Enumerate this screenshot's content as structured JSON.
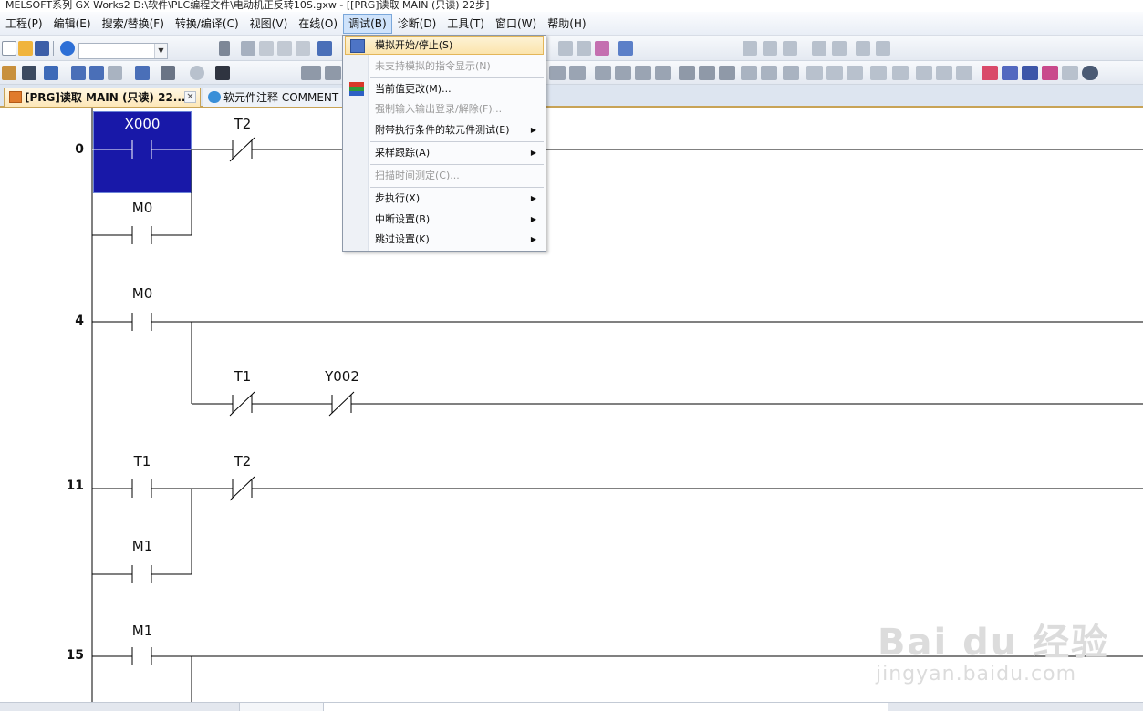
{
  "window": {
    "title": "MELSOFT系列 GX Works2 D:\\软件\\PLC编程文件\\电动机正反转10S.gxw - [[PRG]读取 MAIN (只读) 22步]"
  },
  "menubar": {
    "items": [
      {
        "label": "工程(P)"
      },
      {
        "label": "编辑(E)"
      },
      {
        "label": "搜索/替换(F)"
      },
      {
        "label": "转换/编译(C)"
      },
      {
        "label": "视图(V)"
      },
      {
        "label": "在线(O)"
      },
      {
        "label": "调试(B)",
        "active": true
      },
      {
        "label": "诊断(D)"
      },
      {
        "label": "工具(T)"
      },
      {
        "label": "窗口(W)"
      },
      {
        "label": "帮助(H)"
      }
    ]
  },
  "debug_menu": {
    "items": [
      {
        "label": "模拟开始/停止(S)",
        "enabled": true,
        "highlighted": true,
        "icon": "simulation-icon"
      },
      {
        "label": "未支持模拟的指令显示(N)",
        "enabled": false
      },
      {
        "label": "当前值更改(M)...",
        "enabled": true,
        "icon": "device-value-icon"
      },
      {
        "label": "强制输入输出登录/解除(F)...",
        "enabled": false
      },
      {
        "label": "附带执行条件的软元件测试(E)",
        "enabled": true,
        "submenu": true
      },
      {
        "label": "采样跟踪(A)",
        "enabled": true,
        "submenu": true
      },
      {
        "label": "扫描时间测定(C)...",
        "enabled": false
      },
      {
        "label": "步执行(X)",
        "enabled": true,
        "submenu": true
      },
      {
        "label": "中断设置(B)",
        "enabled": true,
        "submenu": true
      },
      {
        "label": "跳过设置(K)",
        "enabled": true,
        "submenu": true
      }
    ]
  },
  "tabs": [
    {
      "label": "[PRG]读取 MAIN (只读) 22...",
      "active": true
    },
    {
      "label": "软元件注释 COMMENT",
      "active": false
    }
  ],
  "toolbar": {
    "combo_value": ""
  },
  "ladder": {
    "rungs": [
      {
        "step": "0"
      },
      {
        "step": "4"
      },
      {
        "step": "11"
      },
      {
        "step": "15"
      }
    ],
    "devices": {
      "x000": "X000",
      "t2_r0": "T2",
      "m0_r0": "M0",
      "m0_r4": "M0",
      "t1_r4": "T1",
      "y002_r4": "Y002",
      "t1_r11": "T1",
      "t2_r11": "T2",
      "m1_r11": "M1",
      "m1_r15": "M1"
    }
  },
  "watermark": {
    "logo": "Bai du 经验",
    "url": "jingyan.baidu.com"
  }
}
